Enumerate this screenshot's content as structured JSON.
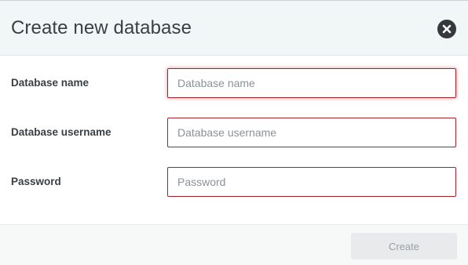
{
  "dialog": {
    "title": "Create new database",
    "close_icon": "close-icon"
  },
  "form": {
    "database_name": {
      "label": "Database name",
      "placeholder": "Database name",
      "value": ""
    },
    "database_username": {
      "label": "Database username",
      "placeholder": "Database username",
      "value": ""
    },
    "password": {
      "label": "Password",
      "placeholder": "Password",
      "value": ""
    }
  },
  "footer": {
    "create_label": "Create"
  },
  "colors": {
    "error_border": "#a8222b",
    "header_bg": "#f1f6f6",
    "close_button": "#35393d",
    "disabled_button_bg": "#e8eaeb"
  }
}
